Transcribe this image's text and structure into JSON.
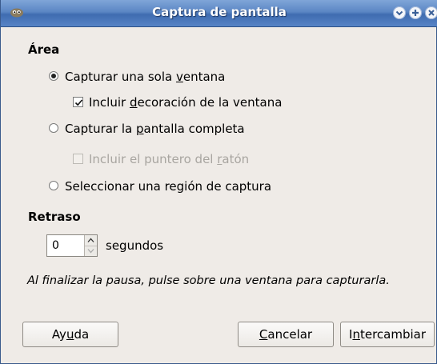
{
  "window": {
    "title": "Captura de pantalla",
    "titlebar_color": "#5b86c4"
  },
  "area": {
    "heading": "Área",
    "options": [
      {
        "pre": "Capturar una sola ",
        "mn": "v",
        "post": "entana",
        "checked": true,
        "enabled": true
      },
      {
        "pre": "Capturar la ",
        "mn": "p",
        "post": "antalla completa",
        "checked": false,
        "enabled": true
      },
      {
        "pre": "Seleccionar una región de captura",
        "mn": "",
        "post": "",
        "checked": false,
        "enabled": true
      }
    ],
    "checks": [
      {
        "pre": "Incluir ",
        "mn": "d",
        "post": "ecoración de la ventana",
        "checked": true,
        "enabled": true
      },
      {
        "pre": "Incluir el puntero del ",
        "mn": "r",
        "post": "atón",
        "checked": false,
        "enabled": false
      }
    ]
  },
  "delay": {
    "heading": "Retraso",
    "value": "0",
    "unit": "segundos"
  },
  "note": "Al finalizar la pausa, pulse sobre una ventana para capturarla.",
  "buttons": {
    "help": {
      "pre": "Ay",
      "mn": "u",
      "post": "da"
    },
    "cancel": {
      "pre": "",
      "mn": "C",
      "post": "ancelar"
    },
    "grab": {
      "pre": "I",
      "mn": "n",
      "post": "tercambiar"
    }
  },
  "icons": {
    "app": "gimp-icon",
    "minimize": "minimize-icon",
    "maximize": "maximize-icon",
    "close": "close-icon"
  }
}
